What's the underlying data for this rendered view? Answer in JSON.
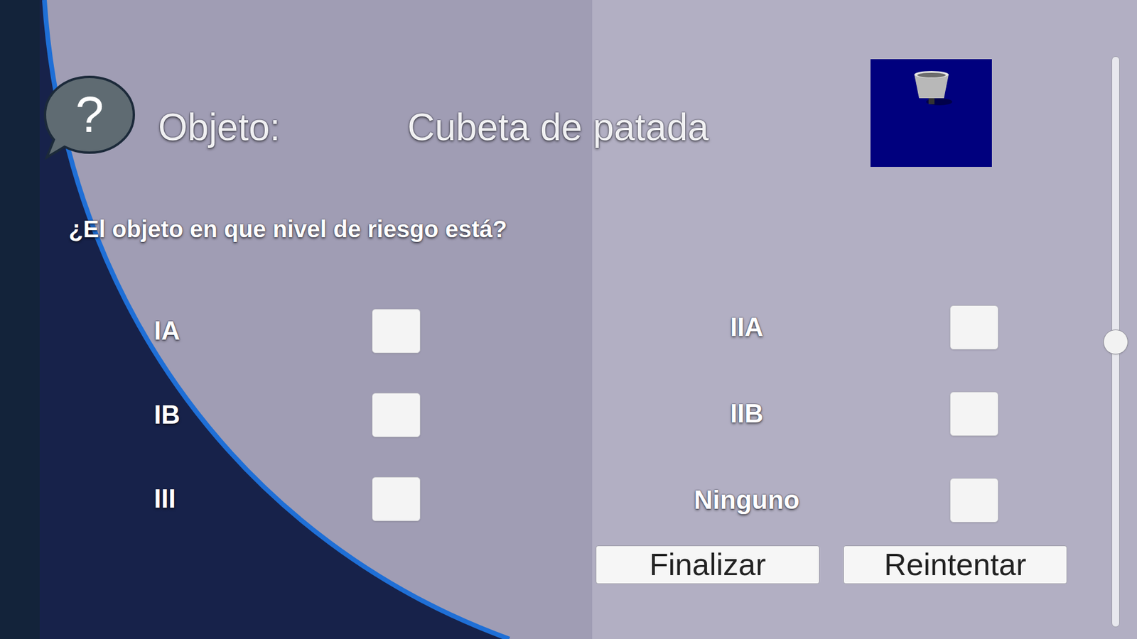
{
  "header": {
    "icon": "?",
    "label": "Objeto:",
    "object_name": "Cubeta de patada"
  },
  "question": "¿El objeto en que nivel de riesgo está?",
  "options": [
    {
      "label": "IA",
      "checked": false
    },
    {
      "label": "IB",
      "checked": false
    },
    {
      "label": "III",
      "checked": false
    },
    {
      "label": "IIA",
      "checked": false
    },
    {
      "label": "IIB",
      "checked": false
    },
    {
      "label": "Ninguno",
      "checked": false
    }
  ],
  "buttons": [
    "Finalizar",
    "Reintentar"
  ],
  "slider": {
    "level": 0.5
  }
}
